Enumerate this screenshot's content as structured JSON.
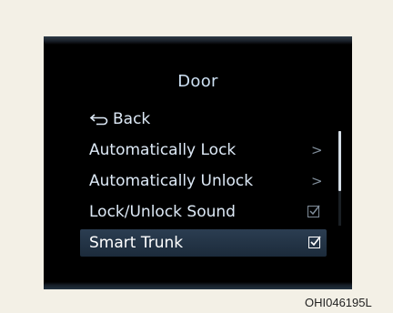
{
  "screen": {
    "title": "Door",
    "back_label": "Back",
    "menu_items": [
      {
        "label": "Automatically Lock",
        "control": "chevron"
      },
      {
        "label": "Automatically Unlock",
        "control": "chevron"
      },
      {
        "label": "Lock/Unlock Sound",
        "control": "checkbox",
        "checked": true
      },
      {
        "label": "Smart Trunk",
        "control": "checkbox",
        "checked": true,
        "selected": true
      }
    ],
    "chevron_glyph": ">"
  },
  "caption": "OHI046195L",
  "colors": {
    "screen_bg": "#000000",
    "text": "#dde9f6",
    "highlight": "#2b3d51",
    "page_bg": "#f3f0e6"
  }
}
